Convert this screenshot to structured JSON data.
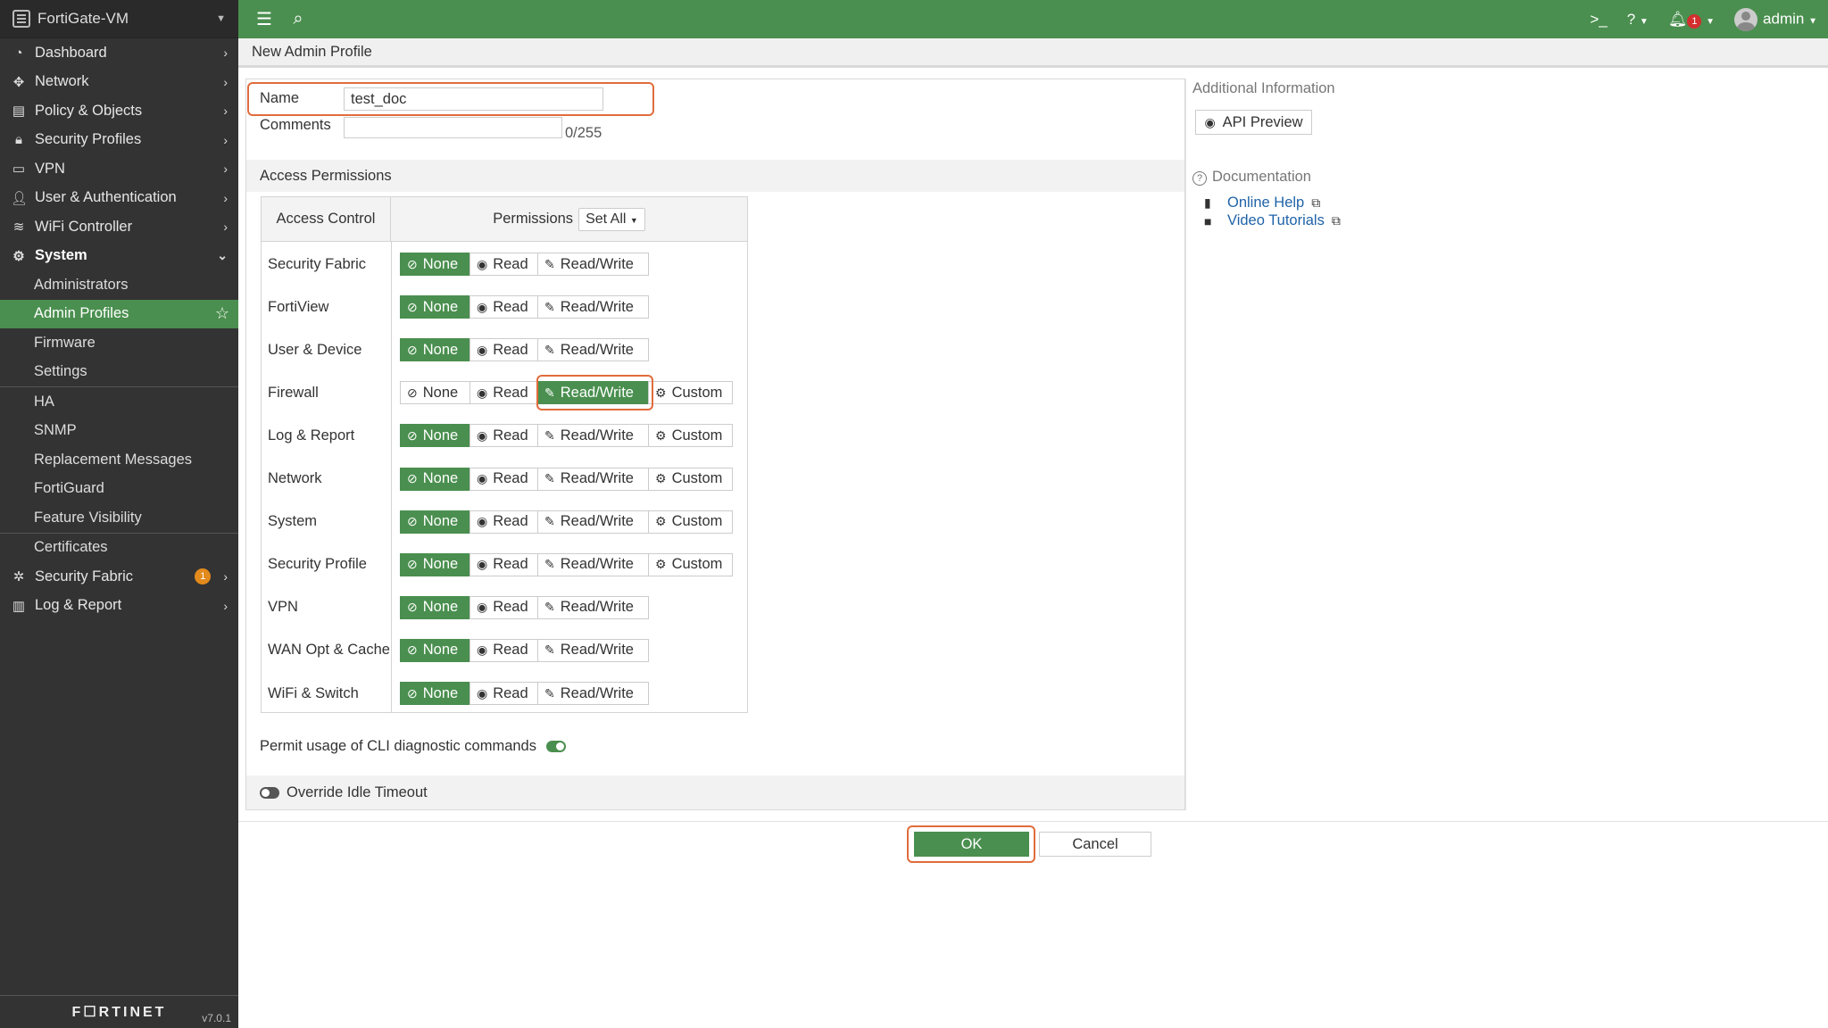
{
  "sidebar": {
    "device": "FortiGate-VM",
    "items": [
      {
        "label": "Dashboard",
        "icon": "dashboard-icon"
      },
      {
        "label": "Network",
        "icon": "network-icon"
      },
      {
        "label": "Policy & Objects",
        "icon": "policy-icon"
      },
      {
        "label": "Security Profiles",
        "icon": "lock-icon"
      },
      {
        "label": "VPN",
        "icon": "laptop-icon"
      },
      {
        "label": "User & Authentication",
        "icon": "user-icon"
      },
      {
        "label": "WiFi Controller",
        "icon": "wifi-icon"
      },
      {
        "label": "System",
        "icon": "gear-icon"
      }
    ],
    "system_sub": [
      "Administrators",
      "Admin Profiles",
      "Firmware",
      "Settings",
      "HA",
      "SNMP",
      "Replacement Messages",
      "FortiGuard",
      "Feature Visibility",
      "Certificates"
    ],
    "security_fabric": {
      "label": "Security Fabric",
      "badge": "1"
    },
    "log_report": {
      "label": "Log & Report"
    },
    "footer_logo": "F☐RTINET",
    "version": "v7.0.1"
  },
  "topbar": {
    "notif_count": "1",
    "user": "admin"
  },
  "page": {
    "title": "New Admin Profile"
  },
  "form": {
    "name_label": "Name",
    "name_value": "test_doc",
    "comments_label": "Comments",
    "comments_counter": "0/255",
    "access_permissions": "Access Permissions",
    "col_access": "Access Control",
    "col_perms": "Permissions",
    "set_all": "Set All",
    "btn_none": "None",
    "btn_read": "Read",
    "btn_rw": "Read/Write",
    "btn_custom": "Custom",
    "rows": [
      {
        "label": "Security Fabric",
        "selected": "none",
        "custom": false
      },
      {
        "label": "FortiView",
        "selected": "none",
        "custom": false
      },
      {
        "label": "User & Device",
        "selected": "none",
        "custom": false
      },
      {
        "label": "Firewall",
        "selected": "rw",
        "custom": true
      },
      {
        "label": "Log & Report",
        "selected": "none",
        "custom": true
      },
      {
        "label": "Network",
        "selected": "none",
        "custom": true
      },
      {
        "label": "System",
        "selected": "none",
        "custom": true
      },
      {
        "label": "Security Profile",
        "selected": "none",
        "custom": true
      },
      {
        "label": "VPN",
        "selected": "none",
        "custom": false
      },
      {
        "label": "WAN Opt & Cache",
        "selected": "none",
        "custom": false
      },
      {
        "label": "WiFi & Switch",
        "selected": "none",
        "custom": false
      }
    ],
    "cli_label": "Permit usage of CLI diagnostic commands",
    "idle_label": "Override Idle Timeout"
  },
  "side": {
    "additional_info": "Additional Information",
    "api_preview": "API Preview",
    "documentation": "Documentation",
    "online_help": "Online Help",
    "video_tutorials": "Video Tutorials"
  },
  "actions": {
    "ok": "OK",
    "cancel": "Cancel"
  },
  "colors": {
    "accent": "#4a8f4f",
    "highlight": "#e06c3c",
    "sidebar_bg": "#333333"
  }
}
